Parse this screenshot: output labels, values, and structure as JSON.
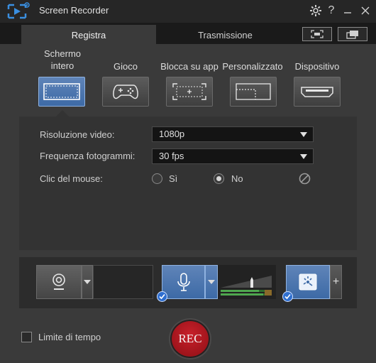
{
  "window": {
    "title": "Screen Recorder"
  },
  "tabs": {
    "record": "Registra",
    "broadcast": "Trasmissione"
  },
  "modes": [
    {
      "label": "Schermo intero",
      "icon": "fullscreen-icon",
      "active": true
    },
    {
      "label": "Gioco",
      "icon": "gamepad-icon",
      "active": false
    },
    {
      "label": "Blocca su app",
      "icon": "lock-to-app-icon",
      "active": false
    },
    {
      "label": "Personalizzato",
      "icon": "custom-area-icon",
      "active": false
    },
    {
      "label": "Dispositivo",
      "icon": "device-hdmi-icon",
      "active": false
    }
  ],
  "settings": {
    "resolution_label": "Risoluzione video:",
    "resolution_value": "1080p",
    "framerate_label": "Frequenza fotogrammi:",
    "framerate_value": "30 fps",
    "mouse_label": "Clic del mouse:",
    "mouse_yes": "Sì",
    "mouse_no": "No",
    "mouse_selected": "No"
  },
  "devices": {
    "webcam_enabled": false,
    "microphone_enabled": true,
    "effects_enabled": true,
    "add_symbol": "+"
  },
  "footer": {
    "time_limit_label": "Limite di tempo",
    "time_limit_checked": false,
    "rec_label": "REC"
  },
  "colors": {
    "accent_blue": "#4a74b0",
    "rec_red": "#b8141c",
    "background": "#3a3a3a"
  }
}
